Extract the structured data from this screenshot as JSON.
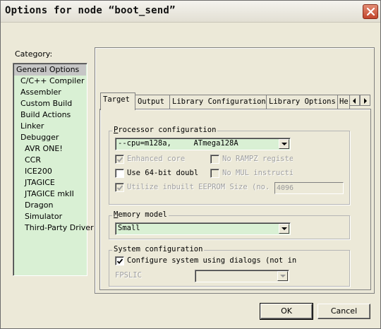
{
  "window": {
    "title": "Options for node “boot_send”",
    "close_icon": "close-icon"
  },
  "category": {
    "label": "Category:",
    "items": [
      {
        "label": "General Options",
        "selected": true,
        "indent": false
      },
      {
        "label": "C/C++ Compiler",
        "selected": false,
        "indent": false
      },
      {
        "label": "Assembler",
        "selected": false,
        "indent": false
      },
      {
        "label": "Custom Build",
        "selected": false,
        "indent": false
      },
      {
        "label": "Build Actions",
        "selected": false,
        "indent": false
      },
      {
        "label": "Linker",
        "selected": false,
        "indent": false
      },
      {
        "label": "Debugger",
        "selected": false,
        "indent": false
      },
      {
        "label": "AVR ONE!",
        "selected": false,
        "indent": true
      },
      {
        "label": "CCR",
        "selected": false,
        "indent": true
      },
      {
        "label": "ICE200",
        "selected": false,
        "indent": true
      },
      {
        "label": "JTAGICE",
        "selected": false,
        "indent": true
      },
      {
        "label": "JTAGICE mkII",
        "selected": false,
        "indent": true
      },
      {
        "label": "Dragon",
        "selected": false,
        "indent": true
      },
      {
        "label": "Simulator",
        "selected": false,
        "indent": true
      },
      {
        "label": "Third-Party Driver",
        "selected": false,
        "indent": true
      }
    ]
  },
  "tabs": [
    {
      "label": "Target",
      "active": true
    },
    {
      "label": "Output",
      "active": false
    },
    {
      "label": "Library Configuration",
      "active": false
    },
    {
      "label": "Library Options",
      "active": false
    },
    {
      "label": "He",
      "active": false
    }
  ],
  "processor": {
    "group_label": "Processor configuration",
    "cpu_value": "--cpu=m128a,     ATmega128A",
    "enhanced_core": {
      "label": "Enhanced core",
      "checked": true,
      "enabled": false
    },
    "no_rampz": {
      "label": "No RAMPZ registe",
      "checked": false,
      "enabled": false
    },
    "use64bit": {
      "label": "Use 64-bit doubl",
      "checked": false,
      "enabled": true
    },
    "no_mul": {
      "label": "No MUL instructi",
      "checked": false,
      "enabled": false
    },
    "utilize_eeprom": {
      "label": "Utilize inbuilt EEPROM  Size (no. o",
      "checked": true,
      "enabled": false
    },
    "eeprom_size": "4096"
  },
  "memory": {
    "group_label": "Memory model",
    "value": "Small"
  },
  "system": {
    "group_label": "System configuration",
    "configure_dialogs": {
      "label": "Configure system using dialogs (not in .",
      "checked": true
    },
    "fpslic_label": "FPSLIC",
    "fpslic_value": ""
  },
  "buttons": {
    "ok": "OK",
    "cancel": "Cancel"
  }
}
